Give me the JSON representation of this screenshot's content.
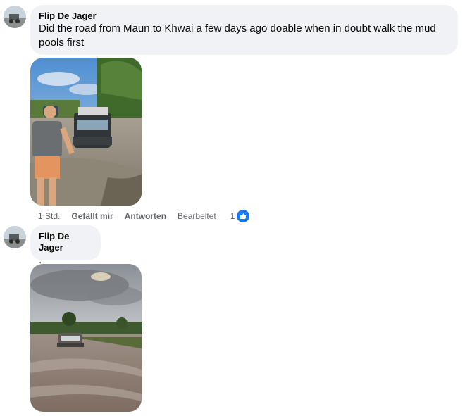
{
  "comments": [
    {
      "author": "Flip De Jager",
      "text": "Did the road from Maun to Khwai a few days ago doable when in doubt walk the mud pools first",
      "actions": {
        "time": "1 Std.",
        "like": "Gefällt mir",
        "reply": "Antworten",
        "edited": "Bearbeitet",
        "reaction_count": "1"
      }
    },
    {
      "author": "Flip De Jager",
      "text": "."
    }
  ],
  "colors": {
    "bubble": "#f0f2f5",
    "like_blue": "#1877f2",
    "meta_text": "#65676b"
  }
}
